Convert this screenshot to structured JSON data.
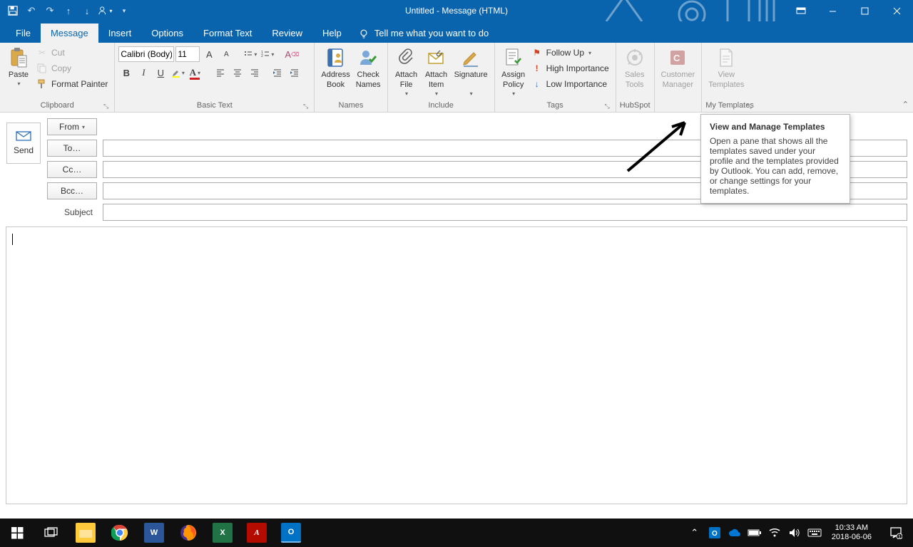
{
  "titlebar": {
    "title": "Untitled  -  Message (HTML)"
  },
  "tabs": {
    "file": "File",
    "message": "Message",
    "insert": "Insert",
    "options": "Options",
    "format_text": "Format Text",
    "review": "Review",
    "help": "Help",
    "tellme": "Tell me what you want to do"
  },
  "ribbon": {
    "clipboard": {
      "paste": "Paste",
      "cut": "Cut",
      "copy": "Copy",
      "format_painter": "Format Painter",
      "label": "Clipboard"
    },
    "basic_text": {
      "font": "Calibri (Body)",
      "size": "11",
      "label": "Basic Text"
    },
    "names": {
      "address_book": "Address\nBook",
      "check_names": "Check\nNames",
      "label": "Names"
    },
    "include": {
      "attach_file": "Attach\nFile",
      "attach_item": "Attach\nItem",
      "signature": "Signature",
      "label": "Include"
    },
    "tags": {
      "assign_policy": "Assign\nPolicy",
      "follow_up": "Follow Up",
      "high_importance": "High Importance",
      "low_importance": "Low Importance",
      "label": "Tags"
    },
    "hubspot": {
      "sales_tools": "Sales\nTools",
      "label": "HubSpot"
    },
    "cust": {
      "customer_manager": "Customer\nManager"
    },
    "templates": {
      "view_templates": "View\nTemplates",
      "label": "My Templates"
    }
  },
  "compose": {
    "send": "Send",
    "from": "From",
    "to": "To…",
    "cc": "Cc…",
    "bcc": "Bcc…",
    "subject": "Subject"
  },
  "tooltip": {
    "title": "View and Manage Templates",
    "body": "Open a pane that shows all the templates saved under your profile and the templates provided by Outlook. You can add, remove, or change settings for your templates."
  },
  "taskbar": {
    "time": "10:33 AM",
    "date": "2018-06-06"
  }
}
